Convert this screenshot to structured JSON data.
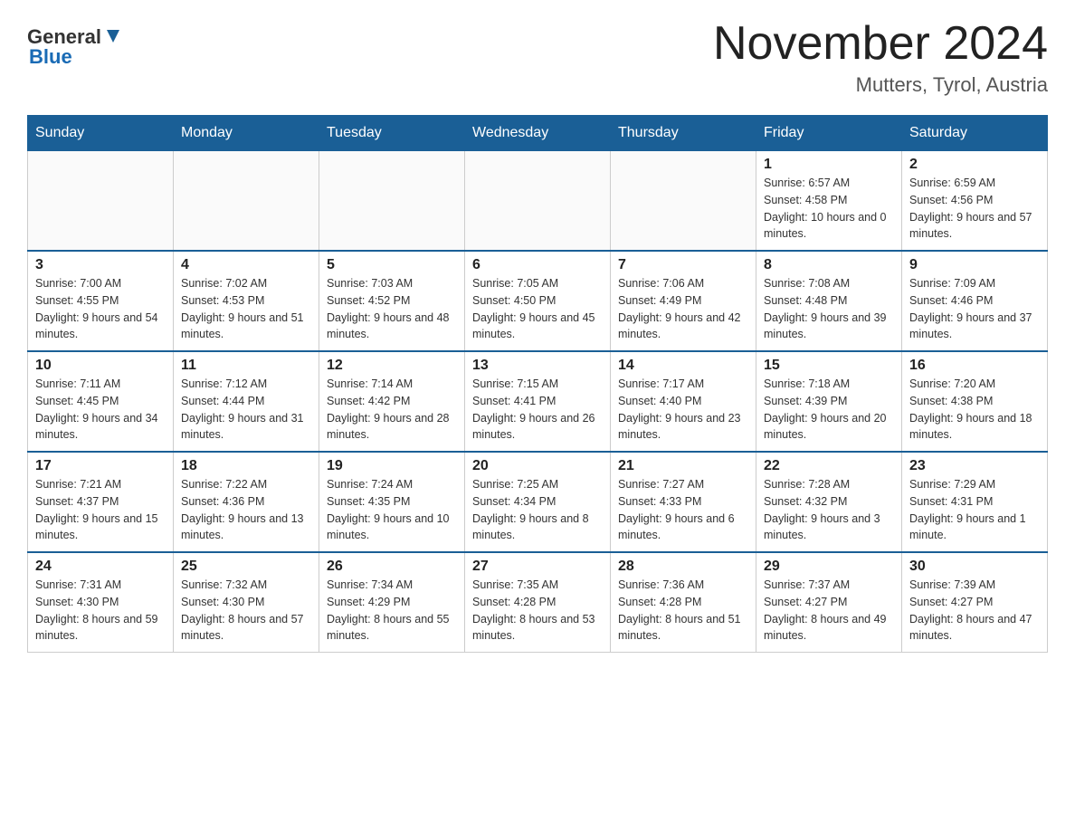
{
  "header": {
    "title": "November 2024",
    "location": "Mutters, Tyrol, Austria",
    "logo_general": "General",
    "logo_blue": "Blue"
  },
  "weekdays": [
    "Sunday",
    "Monday",
    "Tuesday",
    "Wednesday",
    "Thursday",
    "Friday",
    "Saturday"
  ],
  "weeks": [
    [
      {
        "day": "",
        "info": ""
      },
      {
        "day": "",
        "info": ""
      },
      {
        "day": "",
        "info": ""
      },
      {
        "day": "",
        "info": ""
      },
      {
        "day": "",
        "info": ""
      },
      {
        "day": "1",
        "info": "Sunrise: 6:57 AM\nSunset: 4:58 PM\nDaylight: 10 hours and 0 minutes."
      },
      {
        "day": "2",
        "info": "Sunrise: 6:59 AM\nSunset: 4:56 PM\nDaylight: 9 hours and 57 minutes."
      }
    ],
    [
      {
        "day": "3",
        "info": "Sunrise: 7:00 AM\nSunset: 4:55 PM\nDaylight: 9 hours and 54 minutes."
      },
      {
        "day": "4",
        "info": "Sunrise: 7:02 AM\nSunset: 4:53 PM\nDaylight: 9 hours and 51 minutes."
      },
      {
        "day": "5",
        "info": "Sunrise: 7:03 AM\nSunset: 4:52 PM\nDaylight: 9 hours and 48 minutes."
      },
      {
        "day": "6",
        "info": "Sunrise: 7:05 AM\nSunset: 4:50 PM\nDaylight: 9 hours and 45 minutes."
      },
      {
        "day": "7",
        "info": "Sunrise: 7:06 AM\nSunset: 4:49 PM\nDaylight: 9 hours and 42 minutes."
      },
      {
        "day": "8",
        "info": "Sunrise: 7:08 AM\nSunset: 4:48 PM\nDaylight: 9 hours and 39 minutes."
      },
      {
        "day": "9",
        "info": "Sunrise: 7:09 AM\nSunset: 4:46 PM\nDaylight: 9 hours and 37 minutes."
      }
    ],
    [
      {
        "day": "10",
        "info": "Sunrise: 7:11 AM\nSunset: 4:45 PM\nDaylight: 9 hours and 34 minutes."
      },
      {
        "day": "11",
        "info": "Sunrise: 7:12 AM\nSunset: 4:44 PM\nDaylight: 9 hours and 31 minutes."
      },
      {
        "day": "12",
        "info": "Sunrise: 7:14 AM\nSunset: 4:42 PM\nDaylight: 9 hours and 28 minutes."
      },
      {
        "day": "13",
        "info": "Sunrise: 7:15 AM\nSunset: 4:41 PM\nDaylight: 9 hours and 26 minutes."
      },
      {
        "day": "14",
        "info": "Sunrise: 7:17 AM\nSunset: 4:40 PM\nDaylight: 9 hours and 23 minutes."
      },
      {
        "day": "15",
        "info": "Sunrise: 7:18 AM\nSunset: 4:39 PM\nDaylight: 9 hours and 20 minutes."
      },
      {
        "day": "16",
        "info": "Sunrise: 7:20 AM\nSunset: 4:38 PM\nDaylight: 9 hours and 18 minutes."
      }
    ],
    [
      {
        "day": "17",
        "info": "Sunrise: 7:21 AM\nSunset: 4:37 PM\nDaylight: 9 hours and 15 minutes."
      },
      {
        "day": "18",
        "info": "Sunrise: 7:22 AM\nSunset: 4:36 PM\nDaylight: 9 hours and 13 minutes."
      },
      {
        "day": "19",
        "info": "Sunrise: 7:24 AM\nSunset: 4:35 PM\nDaylight: 9 hours and 10 minutes."
      },
      {
        "day": "20",
        "info": "Sunrise: 7:25 AM\nSunset: 4:34 PM\nDaylight: 9 hours and 8 minutes."
      },
      {
        "day": "21",
        "info": "Sunrise: 7:27 AM\nSunset: 4:33 PM\nDaylight: 9 hours and 6 minutes."
      },
      {
        "day": "22",
        "info": "Sunrise: 7:28 AM\nSunset: 4:32 PM\nDaylight: 9 hours and 3 minutes."
      },
      {
        "day": "23",
        "info": "Sunrise: 7:29 AM\nSunset: 4:31 PM\nDaylight: 9 hours and 1 minute."
      }
    ],
    [
      {
        "day": "24",
        "info": "Sunrise: 7:31 AM\nSunset: 4:30 PM\nDaylight: 8 hours and 59 minutes."
      },
      {
        "day": "25",
        "info": "Sunrise: 7:32 AM\nSunset: 4:30 PM\nDaylight: 8 hours and 57 minutes."
      },
      {
        "day": "26",
        "info": "Sunrise: 7:34 AM\nSunset: 4:29 PM\nDaylight: 8 hours and 55 minutes."
      },
      {
        "day": "27",
        "info": "Sunrise: 7:35 AM\nSunset: 4:28 PM\nDaylight: 8 hours and 53 minutes."
      },
      {
        "day": "28",
        "info": "Sunrise: 7:36 AM\nSunset: 4:28 PM\nDaylight: 8 hours and 51 minutes."
      },
      {
        "day": "29",
        "info": "Sunrise: 7:37 AM\nSunset: 4:27 PM\nDaylight: 8 hours and 49 minutes."
      },
      {
        "day": "30",
        "info": "Sunrise: 7:39 AM\nSunset: 4:27 PM\nDaylight: 8 hours and 47 minutes."
      }
    ]
  ]
}
